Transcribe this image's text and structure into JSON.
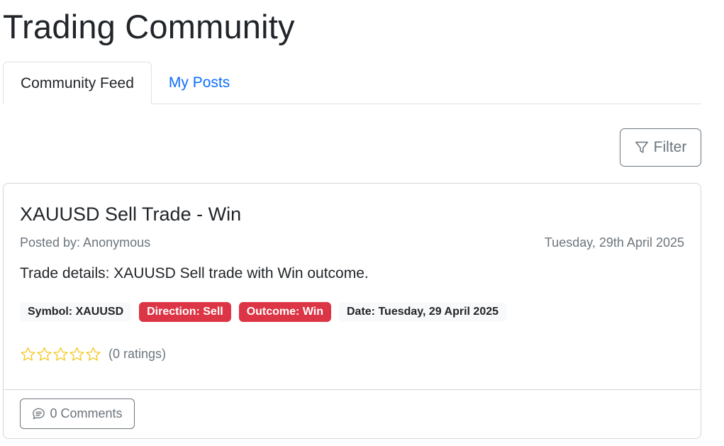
{
  "page": {
    "title": "Trading Community"
  },
  "tabs": [
    {
      "label": "Community Feed",
      "active": true
    },
    {
      "label": "My Posts",
      "active": false
    }
  ],
  "filter": {
    "label": "Filter",
    "icon": "funnel-icon"
  },
  "post": {
    "title": "XAUUSD Sell Trade - Win",
    "posted_by": "Posted by: Anonymous",
    "date": "Tuesday, 29th April 2025",
    "description": "Trade details: XAUUSD Sell trade with Win outcome.",
    "badges": [
      {
        "label": "Symbol: XAUUSD",
        "style": "light"
      },
      {
        "label": "Direction: Sell",
        "style": "danger"
      },
      {
        "label": "Outcome: Win",
        "style": "danger"
      },
      {
        "label": "Date: Tuesday, 29 April 2025",
        "style": "light"
      }
    ],
    "rating": {
      "stars_filled": 0,
      "stars_total": 5,
      "text": "(0 ratings)"
    },
    "comments_label": "0 Comments"
  },
  "colors": {
    "accent": "#0d6efd",
    "danger": "#dc3545",
    "muted": "#6c757d",
    "star": "#f5c518"
  }
}
